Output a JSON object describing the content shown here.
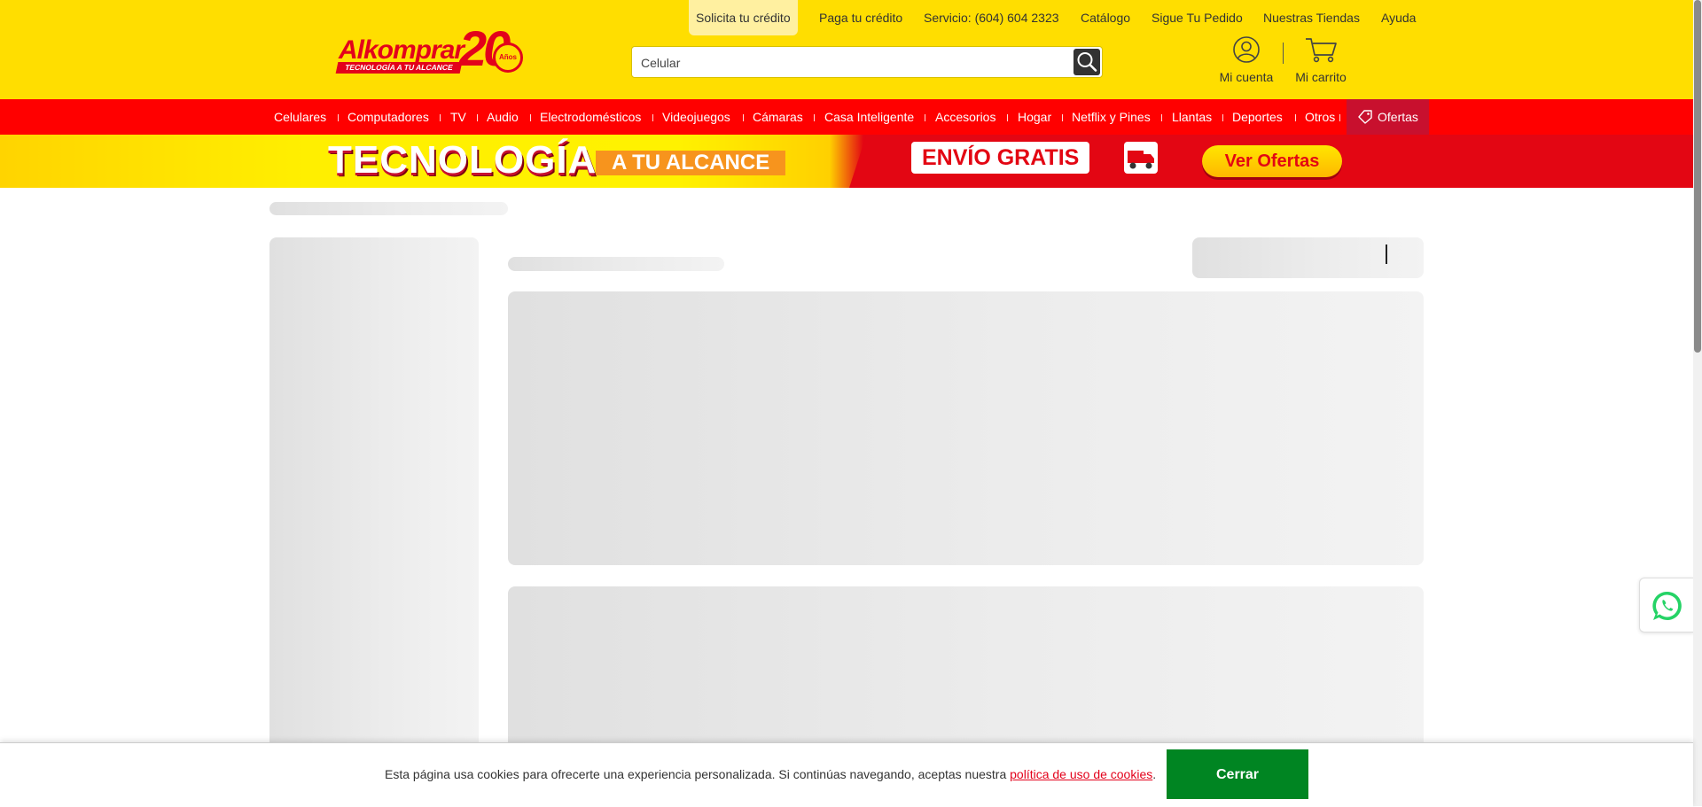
{
  "header": {
    "logo": {
      "brand": "Alkomprar",
      "tagline": "TECNOLOGÍA A TU ALCANCE",
      "anniversary": "20",
      "anniversary_suffix": "Años"
    },
    "top_links": [
      "Solicita tu crédito",
      "Paga tu crédito",
      "Servicio: (604) 604 2323",
      "Catálogo",
      "Sigue Tu Pedido",
      "Nuestras Tiendas",
      "Ayuda"
    ],
    "search": {
      "placeholder": "Celular",
      "button_icon": "search-icon"
    },
    "account": {
      "label": "Mi cuenta",
      "icon": "user-icon"
    },
    "cart": {
      "label": "Mi carrito",
      "icon": "cart-icon"
    }
  },
  "categories": [
    "Celulares",
    "Computadores",
    "TV",
    "Audio",
    "Electrodomésticos",
    "Videojuegos",
    "Cámaras",
    "Casa Inteligente",
    "Accesorios",
    "Hogar",
    "Netflix y Pines",
    "Llantas",
    "Deportes",
    "Otros"
  ],
  "offers": {
    "label": "Ofertas",
    "icon": "tag-icon"
  },
  "banner": {
    "headline": "TECNOLOGÍA",
    "subheadline": "A TU ALCANCE",
    "shipping": "ENVÍO GRATIS",
    "cta": "Ver Ofertas"
  },
  "whatsapp": {
    "icon": "whatsapp-icon"
  },
  "cookie": {
    "text": "Esta página usa cookies para ofrecerte una experiencia personalizada. Si continúas navegando, aceptas nuestra ",
    "link": "política de uso de cookies",
    "after": ".",
    "button": "Cerrar"
  },
  "colors": {
    "header_bg": "#ffde00",
    "nav_bg": "#ff0000",
    "offers_bg": "#c8102e",
    "brand_red": "#e3021b",
    "accept_green": "#008522",
    "skeleton": "#e6e6e6"
  }
}
